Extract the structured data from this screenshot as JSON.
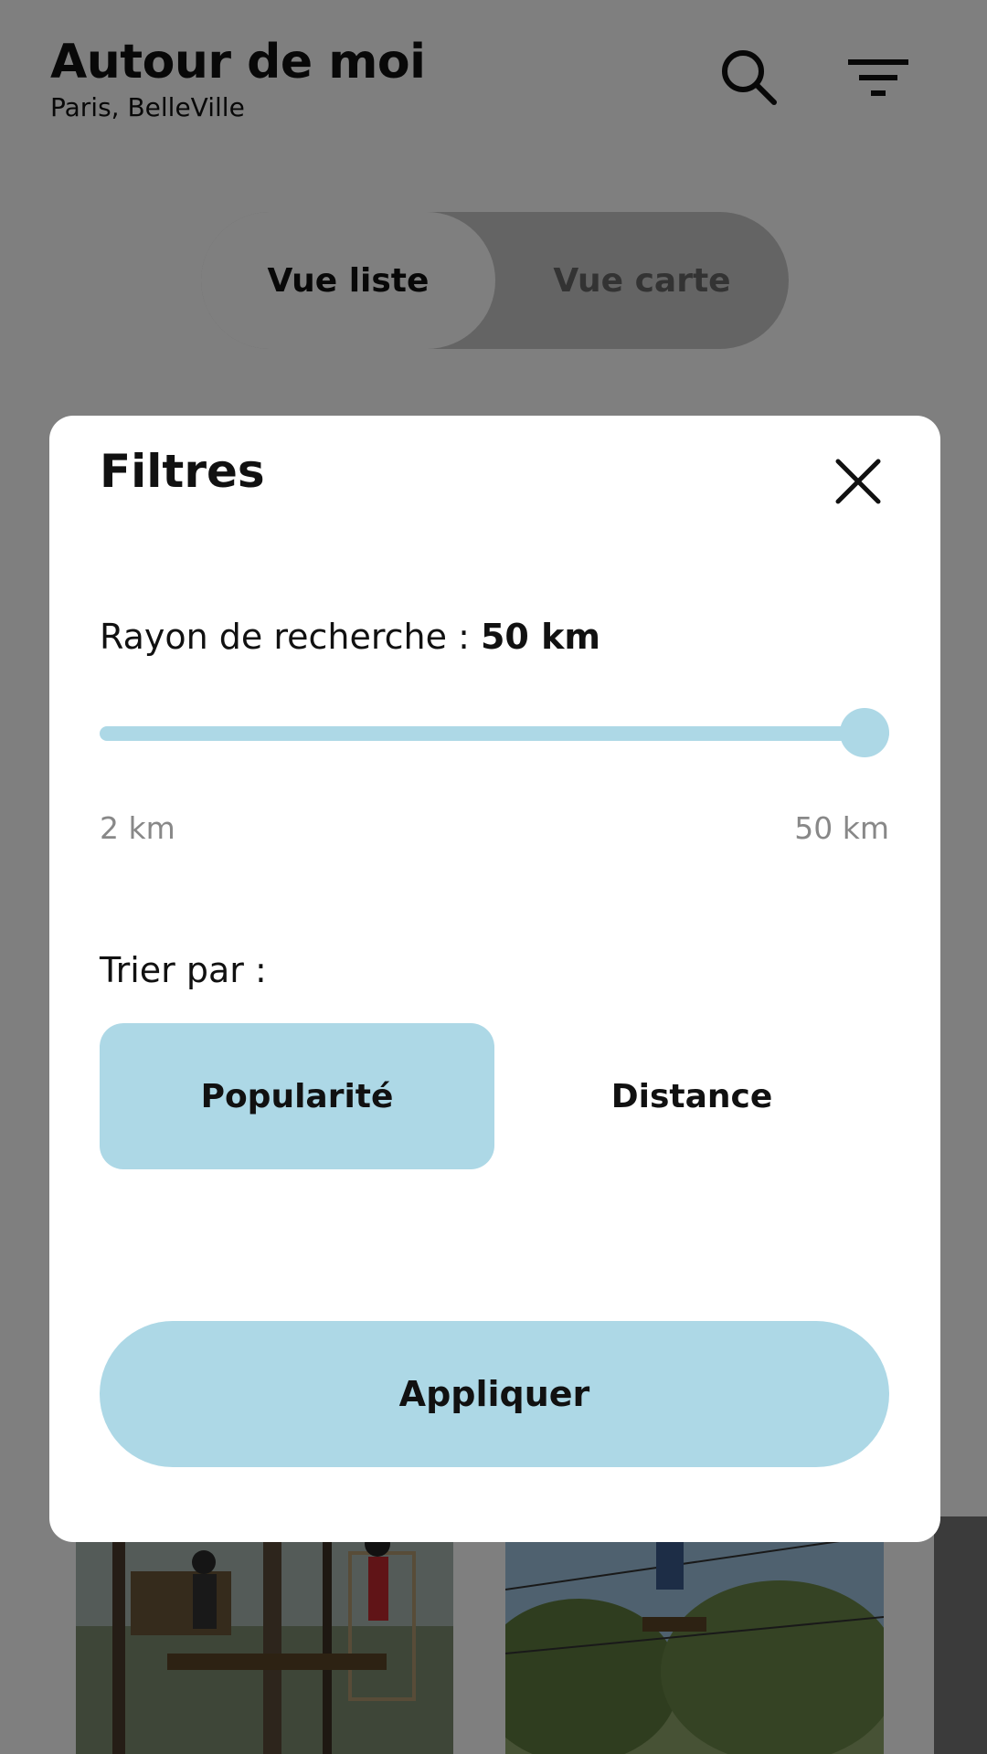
{
  "header": {
    "title": "Autour de moi",
    "location": "Paris, BelleVille",
    "search_icon": "search-icon",
    "filter_icon": "filter-icon"
  },
  "view_toggle": {
    "options": [
      "Vue liste",
      "Vue carte"
    ],
    "selected": "Vue liste"
  },
  "filter_modal": {
    "title": "Filtres",
    "close_icon": "close-icon",
    "radius": {
      "label": "Rayon de recherche : ",
      "value_text": "50 km",
      "min_label": "2 km",
      "max_label": "50 km",
      "min": 2,
      "max": 50,
      "value": 50
    },
    "sort": {
      "label": "Trier par :",
      "options": [
        "Popularité",
        "Distance"
      ],
      "selected": "Popularité"
    },
    "apply_label": "Appliquer"
  },
  "colors": {
    "accent": "#add8e6",
    "overlay": "rgba(0,0,0,0.5)",
    "text": "#111111",
    "muted_text": "#888888"
  }
}
